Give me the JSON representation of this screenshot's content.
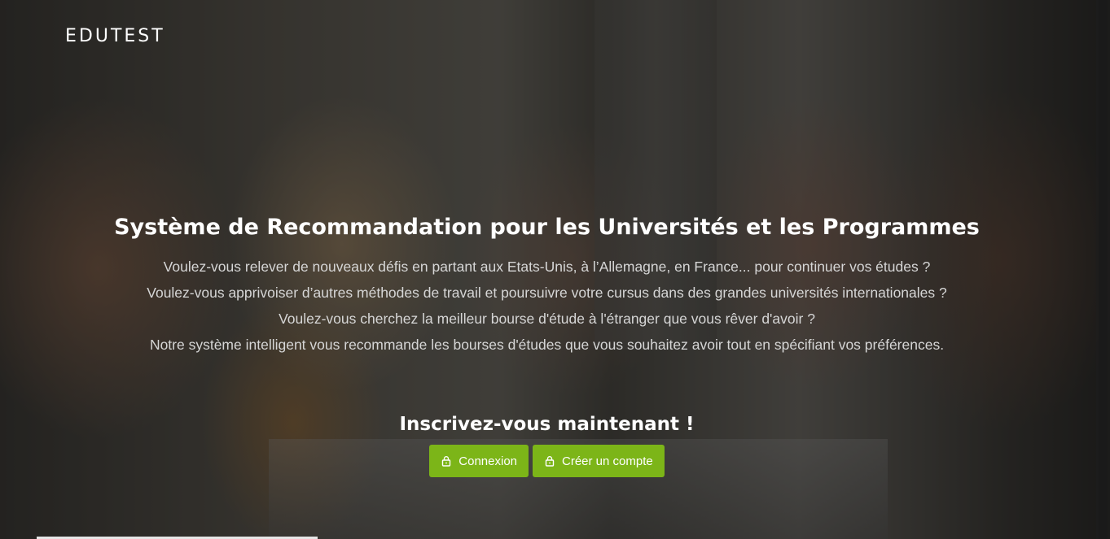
{
  "brand": "EDUTEST",
  "hero": {
    "title": "Système de Recommandation pour les Universités et les Programmes",
    "lines": [
      "Voulez-vous relever de nouveaux défis en partant aux Etats-Unis, à l’Allemagne, en France... pour continuer vos études ?",
      "Voulez-vous apprivoiser d’autres méthodes de travail et poursuivre votre cursus dans des grandes universités internationales ?",
      "Voulez-vous cherchez la meilleur bourse d'étude à l'étranger que vous rêver d'avoir ?",
      "Notre système intelligent vous recommande les bourses d'études que vous souhaitez avoir tout en spécifiant vos préférences."
    ]
  },
  "cta": {
    "title": "Inscrivez-vous maintenant !",
    "login_label": "Connexion",
    "signup_label": "Créer un compte",
    "icon": "lock-icon"
  },
  "colors": {
    "button": "#7cb518",
    "text": "#ffffff",
    "muted_text": "#d6d6d6"
  }
}
